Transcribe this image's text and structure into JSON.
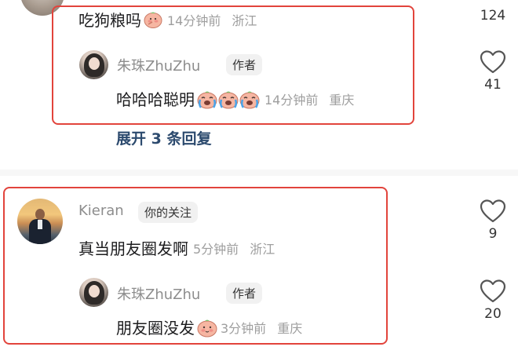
{
  "thread1": {
    "comment": {
      "text": "吃狗粮吗",
      "time": "14分钟前",
      "location": "浙江",
      "likes": "124"
    },
    "reply": {
      "username": "朱珠ZhuZhu",
      "tag": "作者",
      "text": "哈哈哈聪明",
      "time": "14分钟前",
      "location": "重庆",
      "likes": "41"
    },
    "expand_label": "展开 3 条回复"
  },
  "thread2": {
    "comment": {
      "username": "Kieran",
      "tag": "你的关注",
      "text": "真当朋友圈发啊",
      "time": "5分钟前",
      "location": "浙江",
      "likes": "9"
    },
    "reply": {
      "username": "朱珠ZhuZhu",
      "tag": "作者",
      "text": "朋友圈没发",
      "time": "3分钟前",
      "location": "重庆",
      "likes": "20"
    }
  },
  "colors": {
    "highlight": "#e2443c",
    "link": "#2c4a6e",
    "meta": "#9e9e9e"
  },
  "icons": [
    "heart-outline-icon",
    "shy-face-emoji",
    "crying-face-emoji"
  ]
}
